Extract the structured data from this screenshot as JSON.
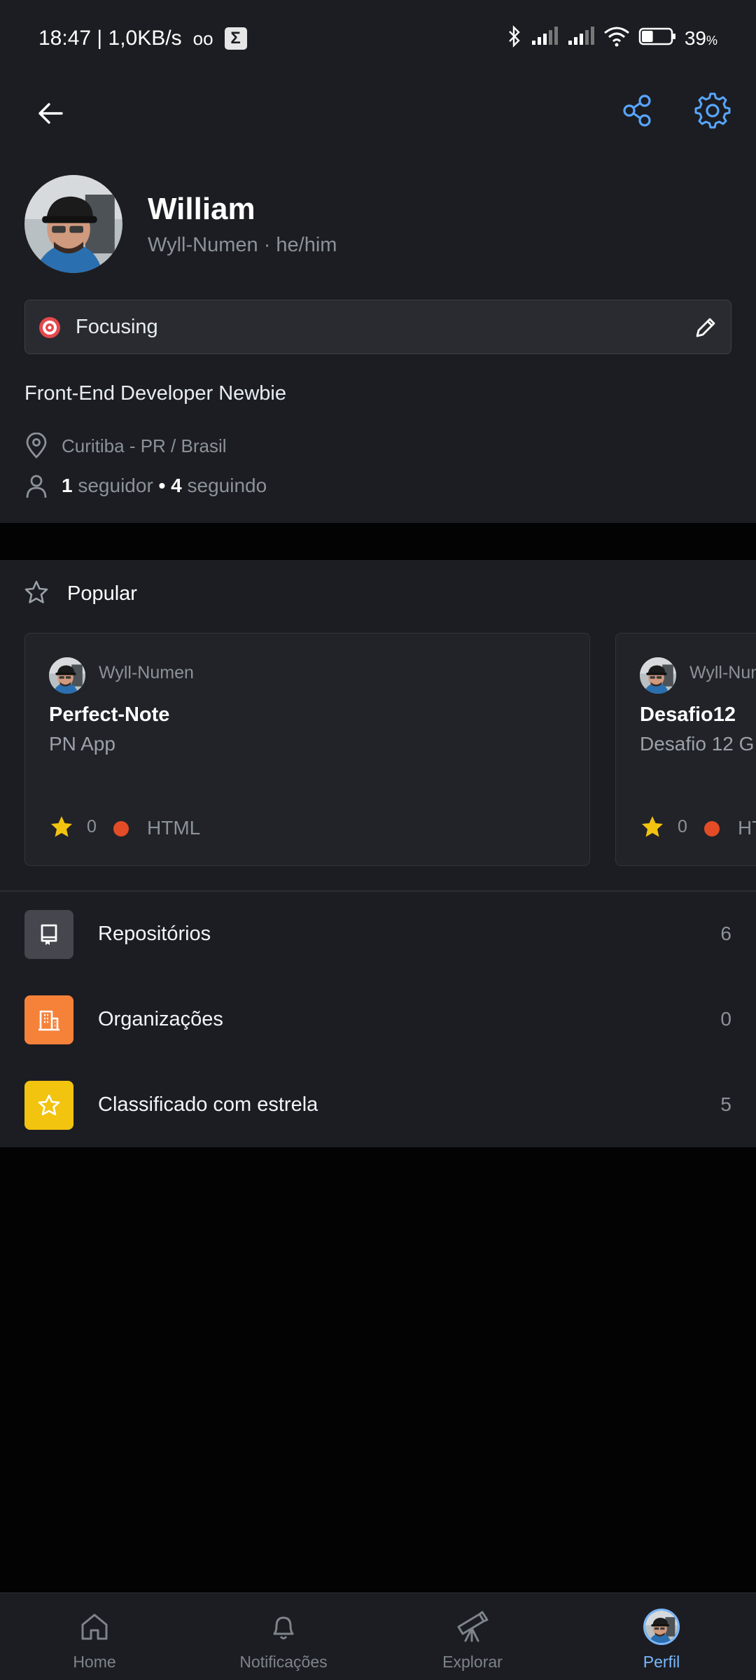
{
  "status_bar": {
    "time_speed": "18:47 | 1,0KB/s",
    "voicemail_glyph": "ᴏᴏ",
    "sigma_glyph": "Σ",
    "battery_percent": "39",
    "battery_unit": "%",
    "battery_level": 0.39
  },
  "header": {
    "back_icon": "arrow-left-icon",
    "share_icon": "share-icon",
    "settings_icon": "gear-icon",
    "accent_color": "#58a6ff"
  },
  "profile": {
    "name": "William",
    "handle": "Wyll-Numen · he/him",
    "status_text": "Focusing",
    "status_emoji": "🎯",
    "bio": "Front-End Developer Newbie",
    "location": "Curitiba - PR / Brasil",
    "followers_count": "1",
    "followers_label": "seguidor",
    "separator": "•",
    "following_count": "4",
    "following_label": "seguindo"
  },
  "popular": {
    "title": "Popular",
    "repos": [
      {
        "owner": "Wyll-Numen",
        "name": "Perfect-Note",
        "description": "PN App",
        "stars": "0",
        "language": "HTML",
        "language_color": "#e34c26"
      },
      {
        "owner": "Wyll-Numen",
        "name": "Desafio12",
        "description": "Desafio 12 G",
        "stars": "0",
        "language": "HT",
        "language_color": "#e34c26"
      }
    ]
  },
  "menu": {
    "items": [
      {
        "label": "Repositórios",
        "count": "6",
        "icon": "repo-icon",
        "color": "#45464e"
      },
      {
        "label": "Organizações",
        "count": "0",
        "icon": "organization-icon",
        "color": "#f6823a"
      },
      {
        "label": "Classificado com estrela",
        "count": "5",
        "icon": "star-icon",
        "color": "#f2c30f"
      }
    ]
  },
  "bottom_nav": {
    "items": [
      {
        "label": "Home",
        "icon": "home-icon"
      },
      {
        "label": "Notificações",
        "icon": "bell-icon"
      },
      {
        "label": "Explorar",
        "icon": "telescope-icon"
      },
      {
        "label": "Perfil",
        "icon": "avatar",
        "active": true
      }
    ]
  }
}
